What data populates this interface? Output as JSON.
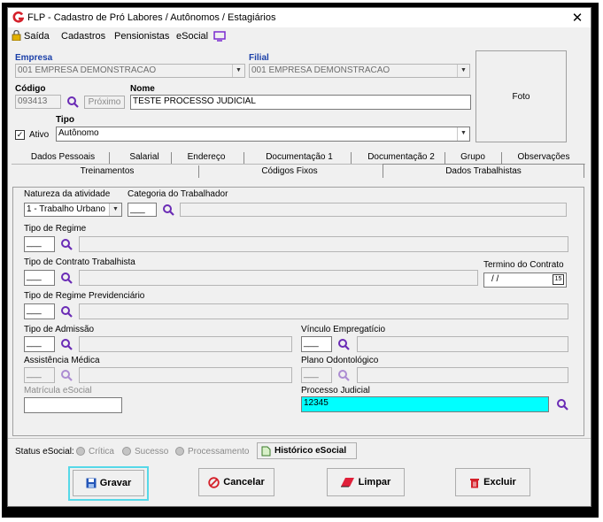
{
  "window": {
    "title": "FLP - Cadastro de Pró Labores / Autônomos / Estagiários",
    "close": "✕"
  },
  "menu": {
    "saida": "Saída",
    "cadastros": "Cadastros",
    "pensionistas": "Pensionistas",
    "esocial": "eSocial"
  },
  "header": {
    "empresa_label": "Empresa",
    "empresa_value": "001 EMPRESA DEMONSTRACAO",
    "filial_label": "Filial",
    "filial_value": "001 EMPRESA DEMONSTRACAO",
    "codigo_label": "Código",
    "codigo_value": "093413",
    "proximo": "Próximo",
    "nome_label": "Nome",
    "nome_value": "TESTE PROCESSO JUDICIAL",
    "tipo_label": "Tipo",
    "tipo_value": "Autônomo",
    "ativo_label": "Ativo",
    "foto_label": "Foto"
  },
  "tabs": {
    "row1": [
      "Dados Pessoais",
      "Salarial",
      "Endereço",
      "Documentação 1",
      "Documentação 2",
      "Grupo",
      "Observações"
    ],
    "row2": [
      "Treinamentos",
      "Códigos Fixos",
      "Dados Trabalhistas"
    ]
  },
  "form": {
    "natureza_label": "Natureza da atividade",
    "natureza_value": "1 - Trabalho Urbano",
    "categoria_label": "Categoria do Trabalhador",
    "categoria_code": "___",
    "regime_label": "Tipo de Regime",
    "regime_code": "___",
    "contrato_label": "Tipo de Contrato Trabalhista",
    "contrato_code": "___",
    "termino_label": "Termino do Contrato",
    "termino_value": "/ /",
    "cal_day": "15",
    "previdenciario_label": "Tipo de Regime Previdenciário",
    "previdenciario_code": "___",
    "admissao_label": "Tipo de Admissão",
    "admissao_code": "___",
    "vinculo_label": "Vínculo Empregatício",
    "vinculo_code": "___",
    "assistencia_label": "Assistência Médica",
    "assistencia_code": "___",
    "odonto_label": "Plano Odontológico",
    "odonto_code": "___",
    "matricula_label": "Matrícula eSocial",
    "matricula_value": "",
    "processo_label": "Processo Judicial",
    "processo_value": "12345"
  },
  "status": {
    "label": "Status eSocial:",
    "critica": "Crítica",
    "sucesso": "Sucesso",
    "processamento": "Processamento",
    "historico": "Histórico eSocial"
  },
  "buttons": {
    "gravar": "Gravar",
    "cancelar": "Cancelar",
    "limpar": "Limpar",
    "excluir": "Excluir"
  },
  "colors": {
    "accent": "#1a3fa8",
    "highlight": "#00ffff",
    "focus": "#56d8e8",
    "icon": "#6a2bb5"
  }
}
